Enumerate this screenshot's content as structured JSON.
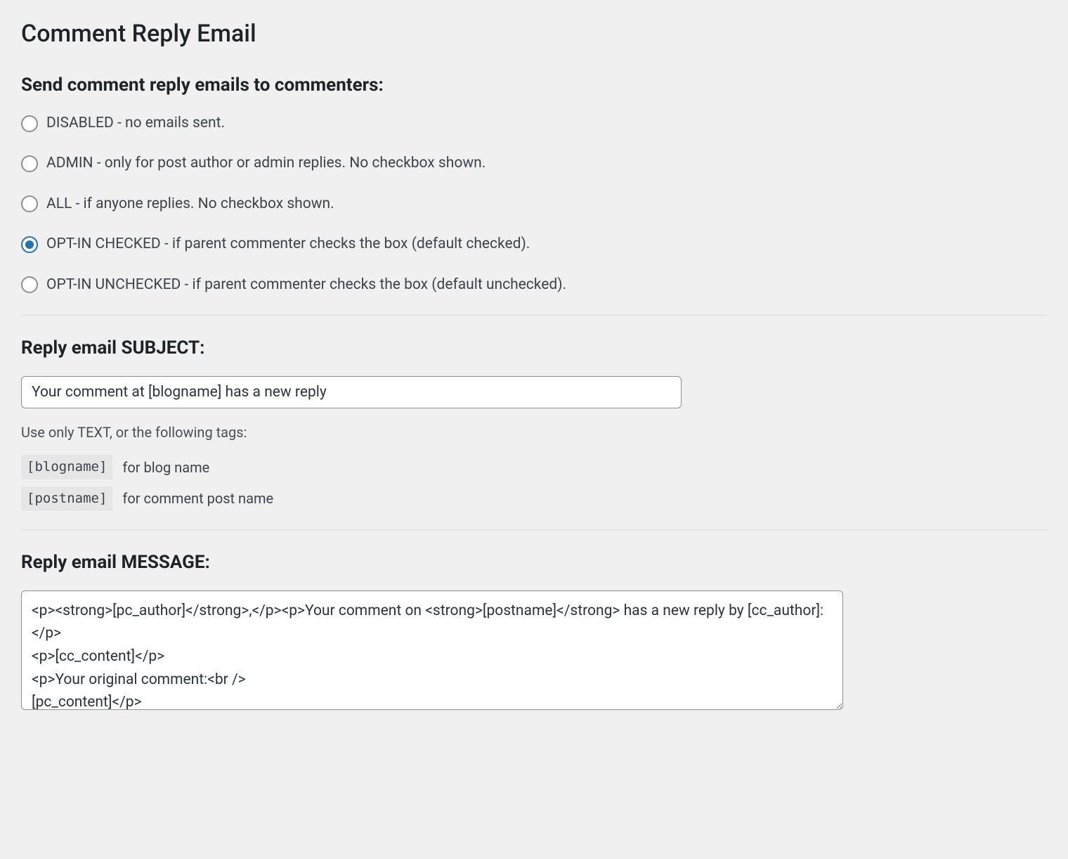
{
  "page": {
    "title": "Comment Reply Email"
  },
  "sendMode": {
    "heading": "Send comment reply emails to commenters:",
    "selectedIndex": 3,
    "options": [
      "DISABLED - no emails sent.",
      "ADMIN - only for post author or admin replies. No checkbox shown.",
      "ALL - if anyone replies. No checkbox shown.",
      "OPT-IN CHECKED - if parent commenter checks the box (default checked).",
      "OPT-IN UNCHECKED - if parent commenter checks the box (default unchecked)."
    ]
  },
  "subject": {
    "heading": "Reply email SUBJECT:",
    "value": "Your comment at [blogname] has a new reply",
    "hint": "Use only TEXT, or the following tags:",
    "tags": [
      {
        "tag": "[blogname]",
        "desc": "for blog name"
      },
      {
        "tag": "[postname]",
        "desc": "for comment post name"
      }
    ]
  },
  "message": {
    "heading": "Reply email MESSAGE:",
    "value": "<p><strong>[pc_author]</strong>,</p><p>Your comment on <strong>[postname]</strong> has a new reply by [cc_author]:</p>\n<p>[cc_content]</p>\n<p>Your original comment:<br />\n[pc_content]</p>"
  }
}
